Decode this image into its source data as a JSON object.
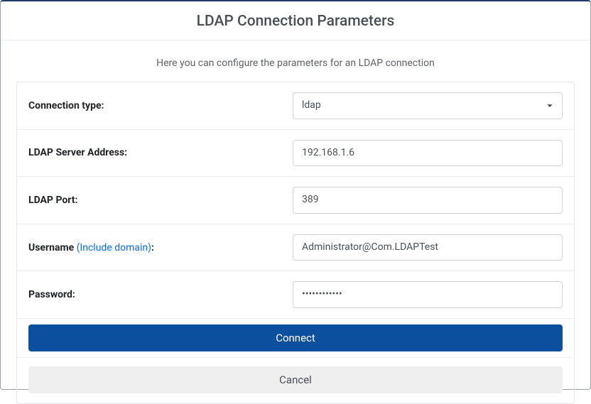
{
  "title": "LDAP Connection Parameters",
  "subtitle": "Here you can configure the parameters for an LDAP connection",
  "fields": {
    "connection_type": {
      "label": "Connection type:",
      "value": "ldap"
    },
    "server_address": {
      "label": "LDAP Server Address:",
      "value": "192.168.1.6"
    },
    "port": {
      "label": "LDAP Port:",
      "value": "389"
    },
    "username": {
      "label_prefix": "Username ",
      "label_hint": "(Include domain)",
      "label_suffix": ":",
      "value": "Administrator@Com.LDAPTest"
    },
    "password": {
      "label": "Password:",
      "value": "••••••••••••"
    }
  },
  "buttons": {
    "connect": "Connect",
    "cancel": "Cancel"
  }
}
